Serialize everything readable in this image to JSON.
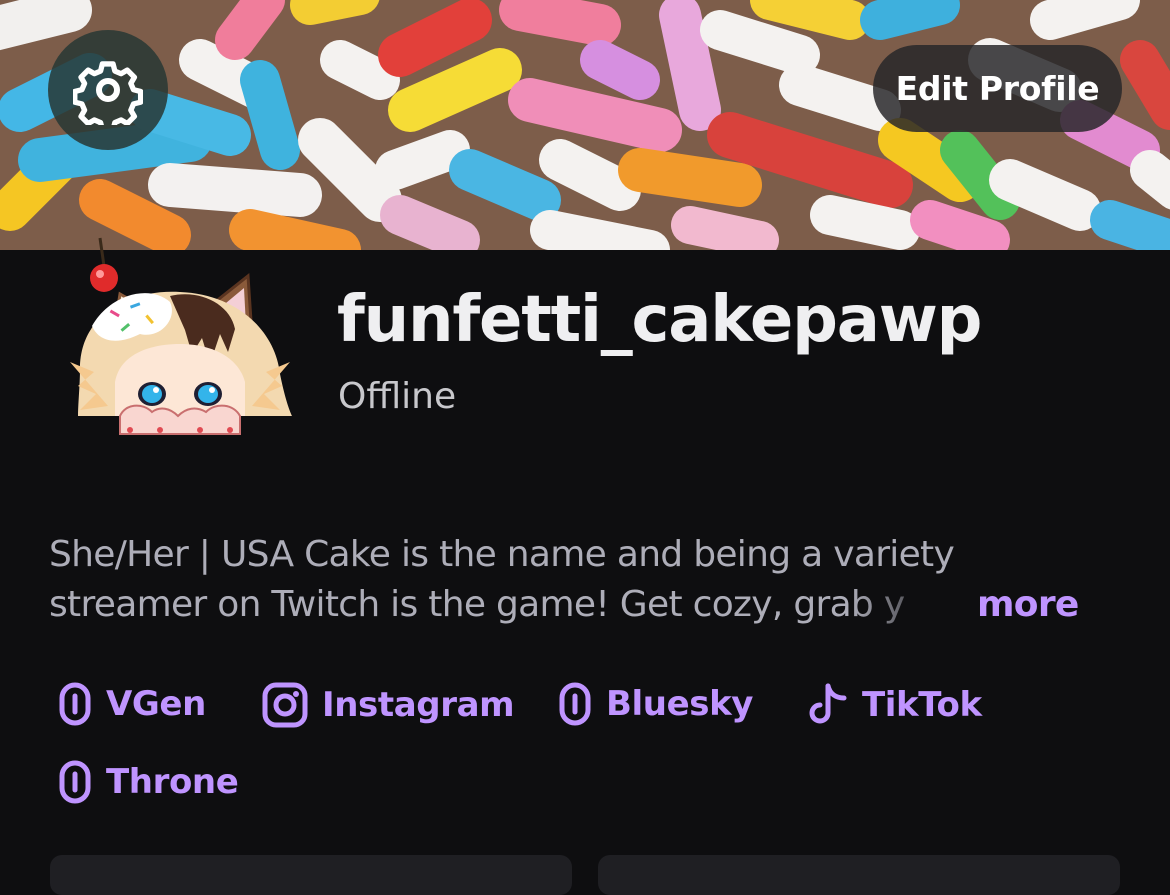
{
  "header": {
    "settings_icon": "gear-icon",
    "edit_profile_label": "Edit Profile"
  },
  "profile": {
    "username": "funfetti_cakepawp",
    "status": "Offline",
    "bio_line1": "She/Her | USA  Cake is the name and being a variety",
    "bio_line2": "streamer on Twitch is the game! Get cozy, grab y",
    "more_label": "more"
  },
  "links": [
    {
      "label": "VGen",
      "icon": "link-icon"
    },
    {
      "label": "Instagram",
      "icon": "instagram-icon"
    },
    {
      "label": "Bluesky",
      "icon": "link-icon"
    },
    {
      "label": "TikTok",
      "icon": "tiktok-icon"
    },
    {
      "label": "Throne",
      "icon": "link-icon"
    }
  ],
  "colors": {
    "background": "#0e0e10",
    "accent": "#bf94ff",
    "text_primary": "#efeff1",
    "text_secondary": "#adadb8"
  }
}
